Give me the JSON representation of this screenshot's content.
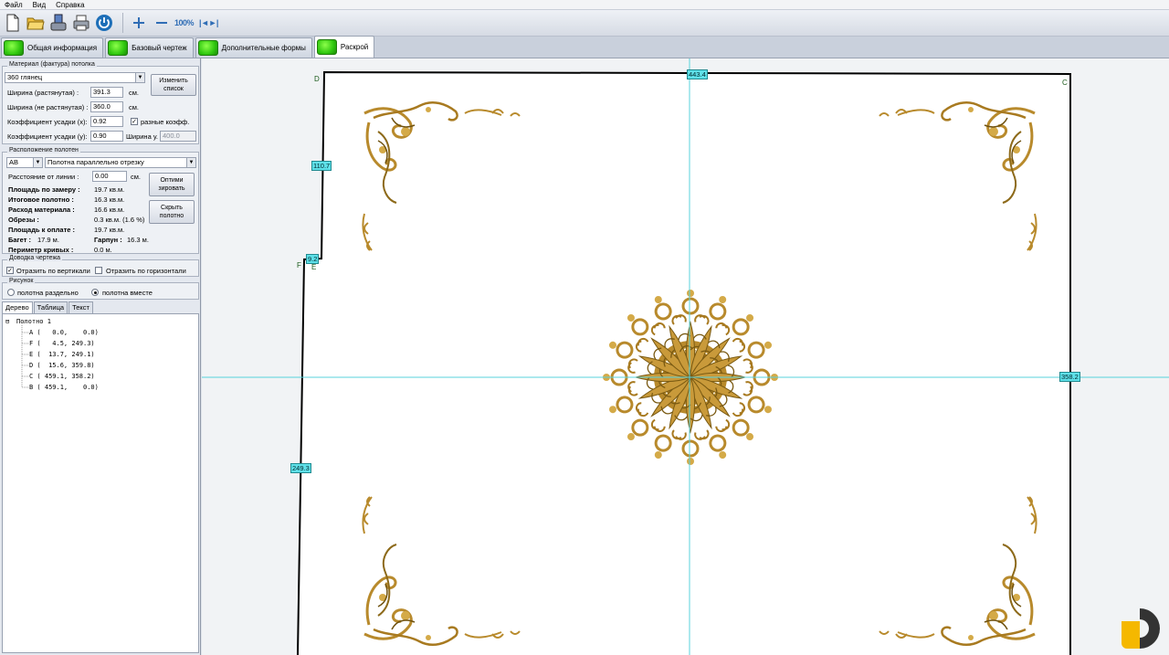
{
  "menu": [
    "Файл",
    "Вид",
    "Справка"
  ],
  "toolbar": {
    "icons": [
      "new-file-icon",
      "open-folder-icon",
      "save-icon",
      "print-icon",
      "power-icon",
      "zoom-in-icon",
      "zoom-out-icon"
    ],
    "zoom_100": "100%",
    "fit": "|◄►|"
  },
  "tabs": [
    "Общая информация",
    "Базовый чертеж",
    "Дополнительные формы",
    "Раскрой"
  ],
  "material": {
    "group_label": "Материал (фактура) потолка",
    "selected": "360 глянец",
    "change_list_button": "Изменить список",
    "width_stretch_label": "Ширина (растянутая) :",
    "width_stretch_value": "391.3",
    "width_nostretch_label": "Ширина (не растянутая) :",
    "width_nostretch_value": "360.0",
    "unit": "см.",
    "shrink_x_label": "Коэффициент усадки (x):",
    "shrink_x_value": "0.92",
    "different_coef_label": "разные коэфф.",
    "shrink_y_label": "Коэффициент усадки (y):",
    "shrink_y_value": "0.90",
    "width_y_label": "Ширина у.",
    "width_y_value": "400.0"
  },
  "layout": {
    "group_label": "Расположение полотен",
    "segment": "AB",
    "mode": "Полотна параллельно отрезку",
    "distance_label": "Расстояние от линии :",
    "distance_value": "0.00",
    "distance_unit": "см.",
    "optimize_button": "Оптими зировать",
    "hide_canvas_button": "Скрыть полотно",
    "stats": [
      {
        "label": "Площадь по замеру :",
        "value": "19.7 кв.м."
      },
      {
        "label": "Итоговое полотно :",
        "value": "16.3 кв.м."
      },
      {
        "label": "Расход материала :",
        "value": "16.6 кв.м."
      },
      {
        "label": "Обрезы :",
        "value": "0.3 кв.м. (1.6 %)"
      },
      {
        "label": "Площадь к оплате :",
        "value": "19.7 кв.м."
      }
    ],
    "baguette_label": "Багет :",
    "baguette_value": "17.9 м.",
    "harpoon_label": "Гарпун :",
    "harpoon_value": "16.3 м.",
    "perimeter_label": "Периметр кривых :",
    "perimeter_value": "0.0 м."
  },
  "finishing": {
    "group_label": "Доводка чертежа",
    "mirror_vertical": "Отразить по вертикали",
    "mirror_horizontal": "Отразить по горизонтали"
  },
  "picture": {
    "group_label": "Рисунок",
    "separate": "полотна раздельно",
    "together": "полотна вместе"
  },
  "tree_tabs": [
    "Дерево",
    "Таблица",
    "Текст"
  ],
  "tree": {
    "root": "Полотно 1",
    "points": [
      "A (   0.0,    0.0)",
      "F (   4.5, 249.3)",
      "E (  13.7, 249.1)",
      "D (  15.6, 359.8)",
      "C ( 459.1, 358.2)",
      "B ( 459.1,    0.0)"
    ]
  },
  "drawing": {
    "points": {
      "D": "D",
      "C": "C",
      "F": "F",
      "E": "E"
    },
    "dims": {
      "top": "443.4",
      "dleft": "110.7",
      "fe": "9.2",
      "left": "249.3",
      "right": "358.2"
    }
  },
  "colors": {
    "accent": "#2f6db5",
    "dim_label": "#5ee0e8",
    "guide_line": "#58d3dc",
    "ornament": "#b88a2c",
    "tab_green": "#2fc60f"
  }
}
